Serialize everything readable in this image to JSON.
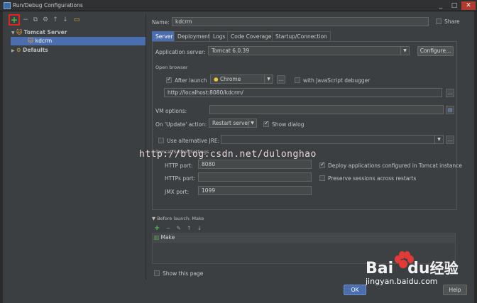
{
  "window": {
    "title": "Run/Debug Configurations",
    "minimize": "_",
    "maximize": "□",
    "close": "✕"
  },
  "toolbar": {
    "add": "+",
    "remove": "−",
    "copy": "⧉",
    "settings": "⚙",
    "up": "↑",
    "down": "↓",
    "folder": "▭"
  },
  "tree": {
    "tomcat_group": "Tomcat Server",
    "tomcat_child": "kdcrm",
    "defaults": "Defaults"
  },
  "header": {
    "name_label": "Name:",
    "name_value": "kdcrm",
    "share_label": "Share"
  },
  "tabs": [
    "Server",
    "Deployment",
    "Logs",
    "Code Coverage",
    "Startup/Connection"
  ],
  "server": {
    "app_server_label": "Application server:",
    "app_server_value": "Tomcat 6.0.39",
    "configure_label": "Configure...",
    "open_browser_label": "Open browser",
    "after_launch_label": "After launch",
    "browser_value": "Chrome",
    "more": "...",
    "js_debugger_label": "with JavaScript debugger",
    "url_value": "http://localhost:8080/kdcrm/",
    "vm_options_label": "VM options:",
    "on_update_label": "On 'Update' action:",
    "on_update_value": "Restart server",
    "show_dialog_label": "Show dialog",
    "alt_jre_label": "Use alternative JRE:",
    "tomcat_settings_label": "Tomcat Server Settings",
    "http_port_label": "HTTP port:",
    "http_port_value": "8080",
    "https_port_label": "HTTPs port:",
    "https_port_value": "",
    "jmx_port_label": "JMX port:",
    "jmx_port_value": "1099",
    "deploy_label": "Deploy applications configured in Tomcat instance",
    "preserve_label": "Preserve sessions across restarts"
  },
  "watermark": "http://blog.csdn.net/dulonghao",
  "before_launch": {
    "title": "Before launch: Make",
    "add": "+",
    "remove": "−",
    "edit": "✎",
    "up": "↑",
    "down": "↓",
    "item": "Make"
  },
  "footer": {
    "show_page_label": "Show this page",
    "ok_label": "OK",
    "help_label": "Help"
  },
  "baidu": {
    "logo_text": "Bai",
    "logo_text2": "du",
    "logo_suffix": "经验",
    "site": "jingyan.baidu.com"
  },
  "colors": {
    "accent": "#4b6eaf",
    "add_highlight": "#e0261b",
    "baidu_red": "#e23b35"
  }
}
